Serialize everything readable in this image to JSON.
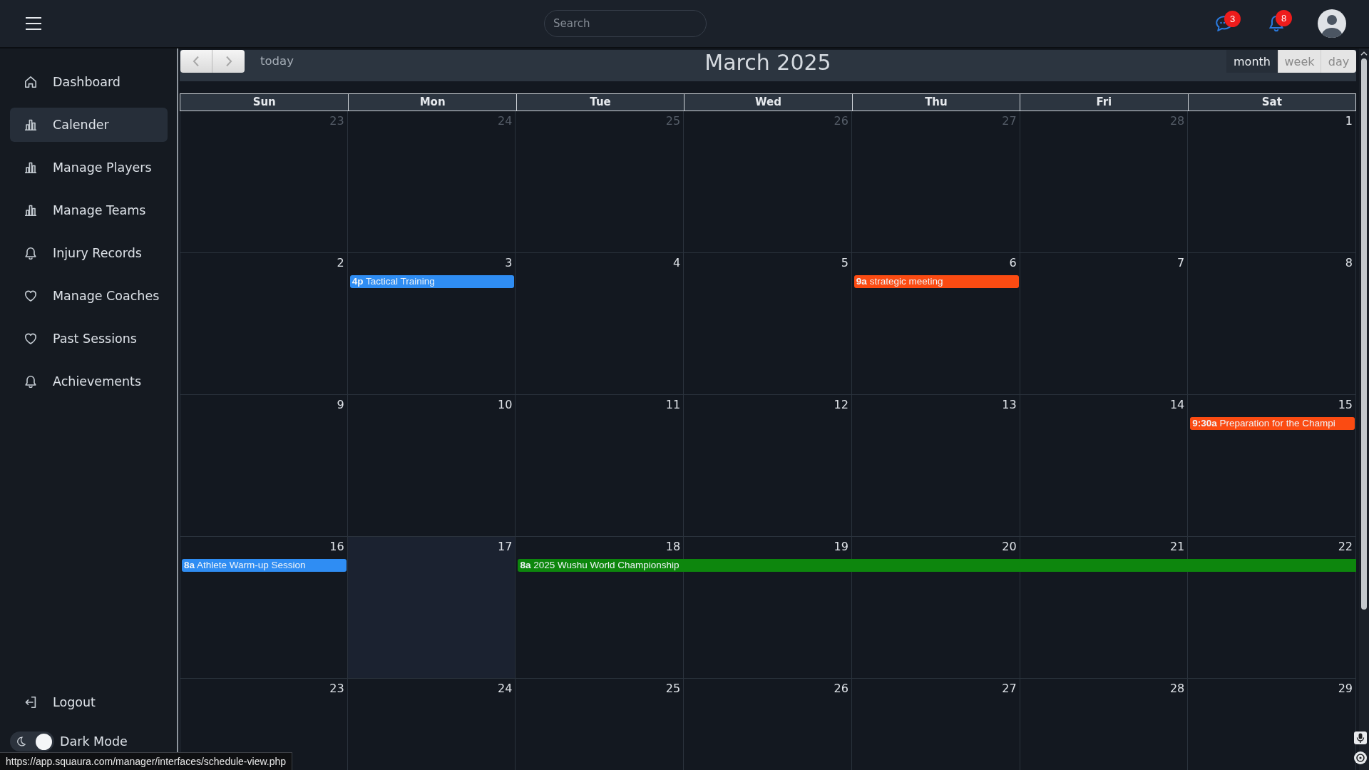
{
  "header": {
    "search": {
      "placeholder": "Search"
    },
    "messages": {
      "count": "3"
    },
    "notifications": {
      "count": "8"
    }
  },
  "sidebar": {
    "items": [
      {
        "label": "Dashboard",
        "kind": "home",
        "selected": false
      },
      {
        "label": "Calender",
        "kind": "chart",
        "selected": true
      },
      {
        "label": "Manage Players",
        "kind": "chart",
        "selected": false
      },
      {
        "label": "Manage Teams",
        "kind": "chart",
        "selected": false
      },
      {
        "label": "Injury Records",
        "kind": "bell",
        "selected": false
      },
      {
        "label": "Manage Coaches",
        "kind": "heart",
        "selected": false
      },
      {
        "label": "Past Sessions",
        "kind": "heart",
        "selected": false
      },
      {
        "label": "Achievements",
        "kind": "bell",
        "selected": false
      }
    ],
    "logout": "Logout",
    "dark_mode": {
      "label": "Dark Mode",
      "on": true
    }
  },
  "calendar": {
    "toolbar": {
      "today": "today",
      "title": "March 2025",
      "views": [
        {
          "label": "month",
          "selected": true
        },
        {
          "label": "week",
          "selected": false
        },
        {
          "label": "day",
          "selected": false
        }
      ]
    },
    "weekdays": [
      "Sun",
      "Mon",
      "Tue",
      "Wed",
      "Thu",
      "Fri",
      "Sat"
    ],
    "weeks": [
      {
        "days": [
          {
            "date": "23",
            "other_month": true,
            "today": false
          },
          {
            "date": "24",
            "other_month": true,
            "today": false
          },
          {
            "date": "25",
            "other_month": true,
            "today": false
          },
          {
            "date": "26",
            "other_month": true,
            "today": false
          },
          {
            "date": "27",
            "other_month": true,
            "today": false
          },
          {
            "date": "28",
            "other_month": true,
            "today": false
          },
          {
            "date": "1",
            "other_month": false,
            "today": false
          }
        ]
      },
      {
        "days": [
          {
            "date": "2",
            "other_month": false,
            "today": false
          },
          {
            "date": "3",
            "other_month": false,
            "today": false,
            "events": [
              {
                "time": "4p",
                "title": "Tactical Training",
                "color": "#2f8df3",
                "continues": false
              }
            ]
          },
          {
            "date": "4",
            "other_month": false,
            "today": false
          },
          {
            "date": "5",
            "other_month": false,
            "today": false
          },
          {
            "date": "6",
            "other_month": false,
            "today": false,
            "events": [
              {
                "time": "9a",
                "title": "strategic meeting",
                "color": "#fb4b12",
                "continues": false
              }
            ]
          },
          {
            "date": "7",
            "other_month": false,
            "today": false
          },
          {
            "date": "8",
            "other_month": false,
            "today": false
          }
        ]
      },
      {
        "days": [
          {
            "date": "9",
            "other_month": false,
            "today": false
          },
          {
            "date": "10",
            "other_month": false,
            "today": false
          },
          {
            "date": "11",
            "other_month": false,
            "today": false
          },
          {
            "date": "12",
            "other_month": false,
            "today": false
          },
          {
            "date": "13",
            "other_month": false,
            "today": false
          },
          {
            "date": "14",
            "other_month": false,
            "today": false
          },
          {
            "date": "15",
            "other_month": false,
            "today": false,
            "events": [
              {
                "time": "9:30a",
                "title": "Preparation for the Champi",
                "color": "#fb4b12",
                "continues": false
              }
            ]
          }
        ]
      },
      {
        "days": [
          {
            "date": "16",
            "other_month": false,
            "today": false,
            "events": [
              {
                "time": "8a",
                "title": "Athlete Warm-up Session",
                "color": "#2f8df3",
                "continues": false
              }
            ]
          },
          {
            "date": "17",
            "other_month": false,
            "today": true
          },
          {
            "date": "18",
            "other_month": false,
            "today": false,
            "events": [
              {
                "time": "8a",
                "title": "2025 Wushu World Championship",
                "color": "#0d860d",
                "continues": true
              }
            ]
          },
          {
            "date": "19",
            "other_month": false,
            "today": false
          },
          {
            "date": "20",
            "other_month": false,
            "today": false
          },
          {
            "date": "21",
            "other_month": false,
            "today": false
          },
          {
            "date": "22",
            "other_month": false,
            "today": false
          }
        ]
      },
      {
        "days": [
          {
            "date": "23",
            "other_month": false,
            "today": false
          },
          {
            "date": "24",
            "other_month": false,
            "today": false
          },
          {
            "date": "25",
            "other_month": false,
            "today": false
          },
          {
            "date": "26",
            "other_month": false,
            "today": false
          },
          {
            "date": "27",
            "other_month": false,
            "today": false
          },
          {
            "date": "28",
            "other_month": false,
            "today": false
          },
          {
            "date": "29",
            "other_month": false,
            "today": false
          }
        ]
      }
    ]
  },
  "status_bar": {
    "url": "https://app.squaura.com/manager/interfaces/schedule-view.php"
  }
}
